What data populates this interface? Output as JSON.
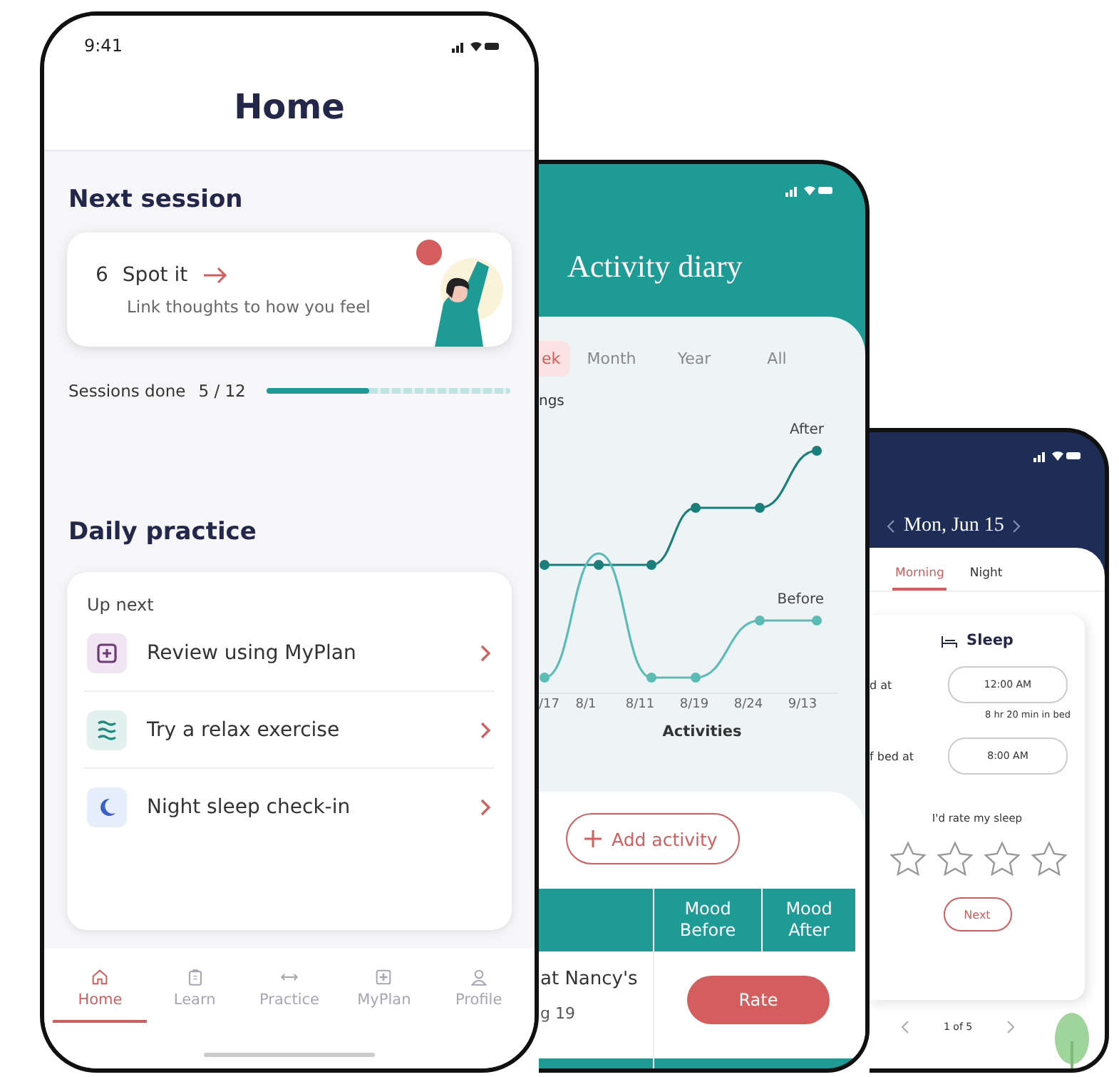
{
  "home_phone": {
    "status_time": "9:41",
    "title": "Home",
    "next_session": {
      "heading": "Next session",
      "number": "6",
      "title": "Spot it",
      "subtitle": "Link thoughts to how you feel"
    },
    "progress": {
      "label": "Sessions done",
      "count": "5 / 12",
      "level": 0.42
    },
    "daily_practice": {
      "heading": "Daily practice",
      "subheading": "Up next",
      "items": [
        {
          "label": "Review using MyPlan"
        },
        {
          "label": "Try a relax exercise"
        },
        {
          "label": "Night sleep check-in"
        }
      ]
    },
    "tab_bar": [
      {
        "label": "Home",
        "selected": true
      },
      {
        "label": "Learn",
        "selected": false
      },
      {
        "label": "Practice",
        "selected": false
      },
      {
        "label": "MyPlan",
        "selected": false
      },
      {
        "label": "Profile",
        "selected": false
      }
    ]
  },
  "diary_phone": {
    "title": "Activity diary",
    "tabs": [
      {
        "label": "ek",
        "selected": true
      },
      {
        "label": "Month",
        "selected": false
      },
      {
        "label": "Year",
        "selected": false
      },
      {
        "label": "All",
        "selected": false
      }
    ],
    "chart": {
      "ylabel": "ngs",
      "series_labels": [
        "After",
        "Before"
      ],
      "x_labels": [
        "/17",
        "8/1",
        "8/11",
        "8/19",
        "8/24",
        "9/13"
      ],
      "xlabel": "Activities"
    },
    "add_button": "Add activity",
    "table": {
      "columns": [
        "Mood Before",
        "Mood After"
      ],
      "rows": [
        {
          "activity": "at Nancy's",
          "date": "g 19",
          "action": "Rate"
        }
      ]
    }
  },
  "sleep_phone": {
    "date": "Mon, Jun 15",
    "tabs": [
      {
        "label": "Morning",
        "selected": true
      },
      {
        "label": "Night",
        "selected": false
      }
    ],
    "card": {
      "title": "Sleep",
      "fields": [
        {
          "label": "d at",
          "value": "12:00 AM",
          "note": "8 hr 20 min in bed"
        },
        {
          "label": "f bed at",
          "value": "8:00 AM"
        }
      ],
      "rating_label": "I'd rate my sleep",
      "stars": 0,
      "next_button": "Next"
    },
    "pager": "1 of 5"
  }
}
